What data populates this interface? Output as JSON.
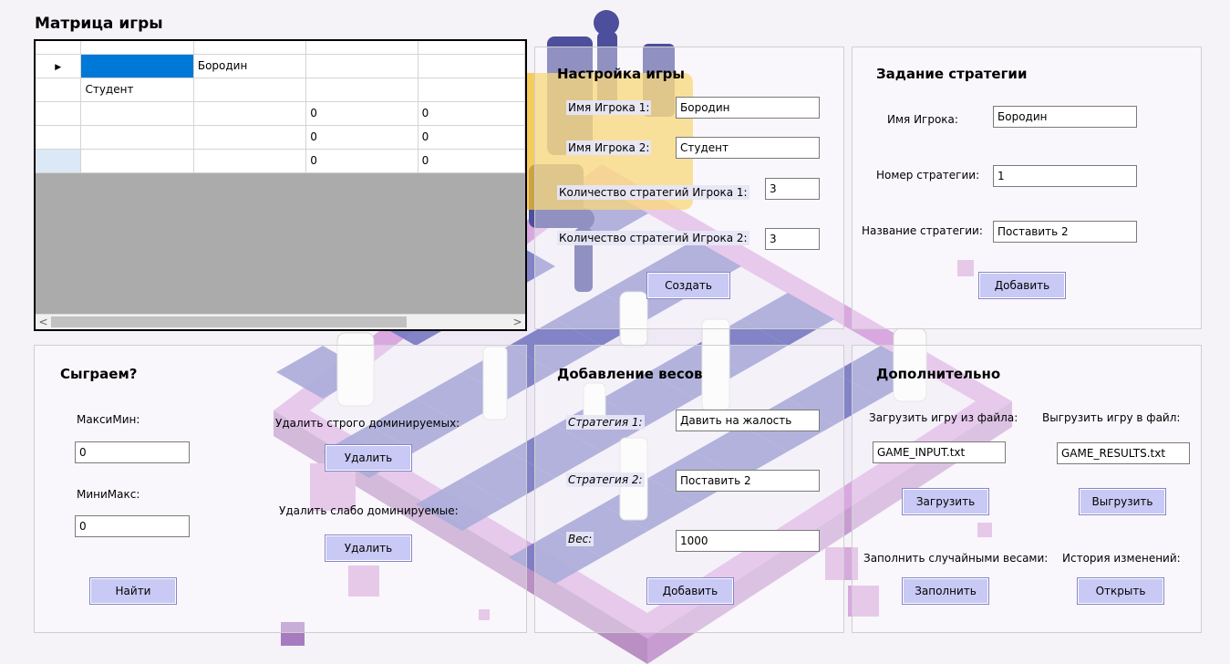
{
  "title": "Матрица игры",
  "grid": {
    "columns": [
      "",
      "",
      "",
      ""
    ],
    "rows": [
      {
        "pointer": "▶",
        "cells": [
          "",
          "Бородин",
          "",
          ""
        ]
      },
      {
        "pointer": "",
        "cells": [
          "Студент",
          "",
          "",
          ""
        ]
      },
      {
        "pointer": "",
        "cells": [
          "",
          "",
          "0",
          "0"
        ]
      },
      {
        "pointer": "",
        "cells": [
          "",
          "",
          "0",
          "0"
        ]
      },
      {
        "pointer": "",
        "cells": [
          "",
          "",
          "0",
          "0"
        ]
      }
    ],
    "scroll_left": "<",
    "scroll_right": ">"
  },
  "setup": {
    "title": "Настройка игры",
    "player1_label": "Имя Игрока 1:",
    "player1_value": "Бородин",
    "player2_label": "Имя Игрока 2:",
    "player2_value": "Студент",
    "strategies1_label": "Количество стратегий Игрока 1:",
    "strategies1_value": "3",
    "strategies2_label": "Количество стратегий Игрока 2:",
    "strategies2_value": "3",
    "create_button": "Создать"
  },
  "strategy": {
    "title": "Задание стратегии",
    "player_label": "Имя Игрока:",
    "player_value": "Бородин",
    "number_label": "Номер стратегии:",
    "number_value": "1",
    "name_label": "Название стратегии:",
    "name_value": "Поставить 2",
    "add_button": "Добавить"
  },
  "play": {
    "title": "Сыграем?",
    "maximin_label": "МаксиМин:",
    "maximin_value": "0",
    "minimax_label": "МиниМакс:",
    "minimax_value": "0",
    "find_button": "Найти",
    "strict_label": "Удалить строго доминируемых:",
    "strict_button": "Удалить",
    "weak_label": "Удалить слабо доминируемые:",
    "weak_button": "Удалить"
  },
  "weights": {
    "title": "Добавление весов",
    "s1_label": "Стратегия 1:",
    "s1_value": "Давить на жалость",
    "s2_label": "Стратегия 2:",
    "s2_value": "Поставить 2",
    "w_label": "Вес:",
    "w_value": "1000",
    "add_button": "Добавить"
  },
  "extra": {
    "title": "Дополнительно",
    "load_label": "Загрузить игру из файла:",
    "load_value": "GAME_INPUT.txt",
    "load_button": "Загрузить",
    "save_label": "Выгрузить игру в файл:",
    "save_value": "GAME_RESULTS.txt",
    "save_button": "Выгрузить",
    "fill_label": "Заполнить случайными весами:",
    "fill_button": "Заполнить",
    "history_label": "История изменений:",
    "history_button": "Открыть"
  },
  "colors": {
    "button_bg": "#c9c9f5",
    "selected_cell": "#0078d7",
    "board_dark": "#7b7bc4",
    "board_frame": "#c99bd6"
  }
}
